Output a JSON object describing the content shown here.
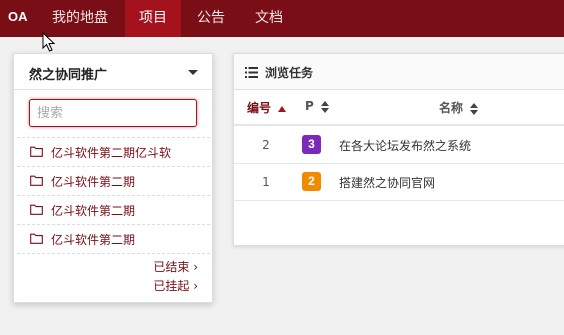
{
  "nav": {
    "brand": "OA",
    "items": [
      {
        "label": "我的地盘",
        "active": false
      },
      {
        "label": "项目",
        "active": true
      },
      {
        "label": "公告",
        "active": false
      },
      {
        "label": "文档",
        "active": false
      }
    ]
  },
  "project_panel": {
    "title": "然之协同推广",
    "search": {
      "placeholder": "搜索",
      "value": ""
    },
    "items": [
      {
        "label": "亿斗软件第二期亿斗软"
      },
      {
        "label": "亿斗软件第二期"
      },
      {
        "label": "亿斗软件第二期"
      },
      {
        "label": "亿斗软件第二期"
      }
    ],
    "links": {
      "finished": "已结束 ›",
      "suspended": "已挂起 ›"
    }
  },
  "task_panel": {
    "title": "浏览任务",
    "columns": {
      "id": "编号",
      "priority": "P",
      "name": "名称"
    },
    "rows": [
      {
        "id": "2",
        "priority": "3",
        "priority_color": "#7b29b8",
        "name": "在各大论坛发布然之系统"
      },
      {
        "id": "1",
        "priority": "2",
        "priority_color": "#f08a00",
        "name": "搭建然之协同官网"
      }
    ]
  },
  "colors": {
    "brand": "#7a0e16",
    "nav_active": "#a4121d"
  }
}
